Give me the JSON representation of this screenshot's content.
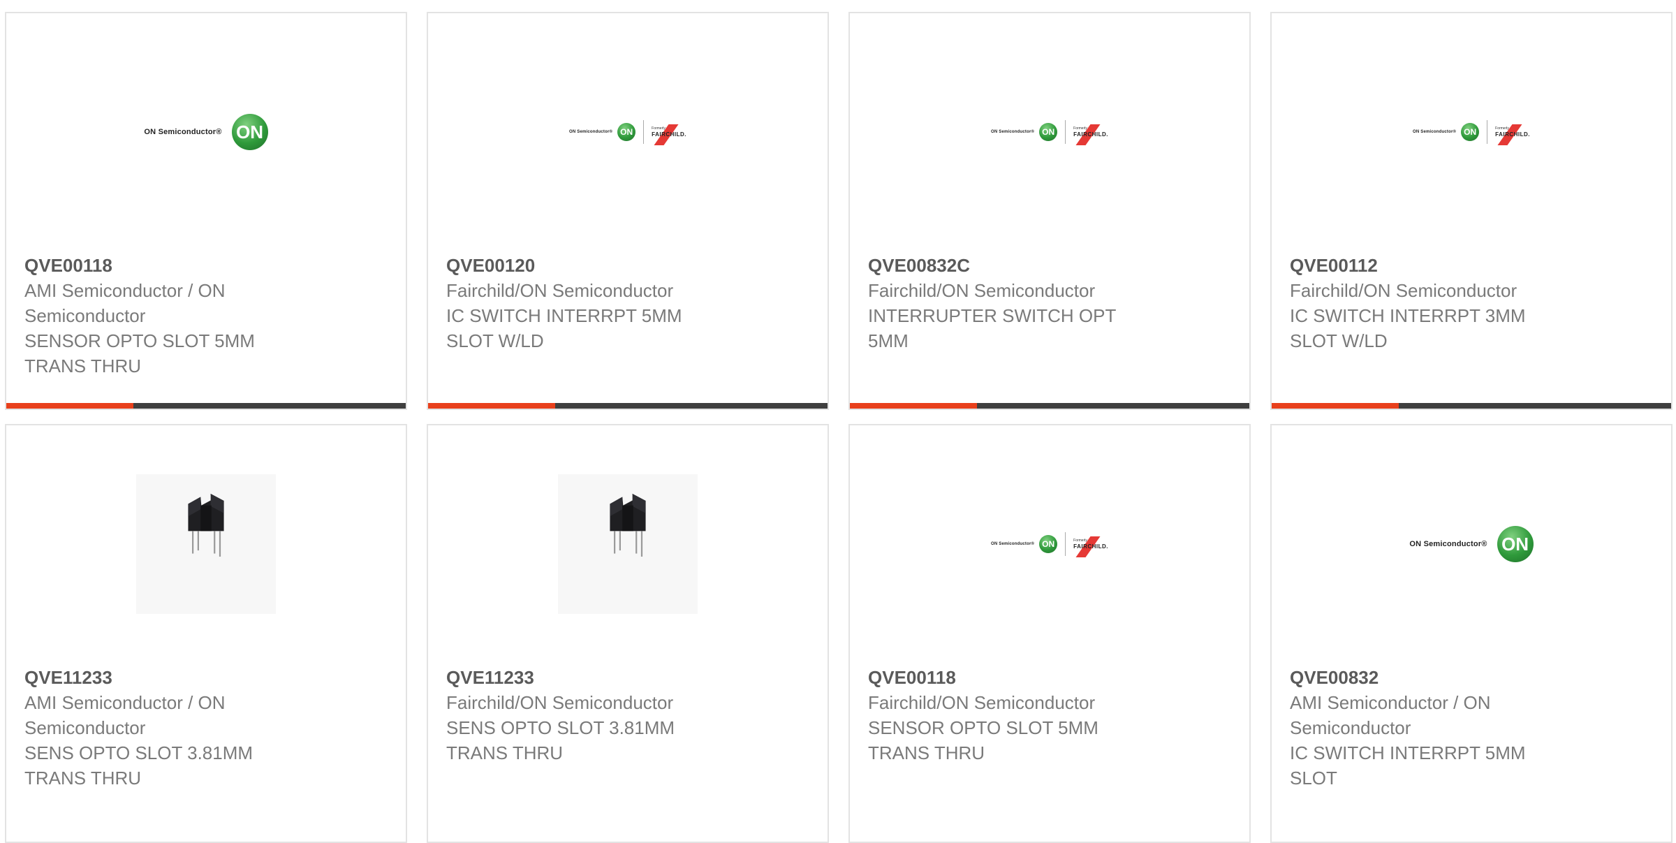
{
  "products": [
    {
      "part_number": "QVE00118",
      "manufacturer": "AMI Semiconductor / ON Semiconductor",
      "description": "SENSOR OPTO SLOT 5MM TRANS THRU",
      "image": "on-logo",
      "logo": {
        "text": "ON Semiconductor®",
        "mark": "ON"
      }
    },
    {
      "part_number": "QVE00120",
      "manufacturer": "Fairchild/ON Semiconductor",
      "description": "IC SWITCH INTERRPT 5MM SLOT W/LD",
      "image": "on-fairchild-logo",
      "logo": {
        "text": "ON Semiconductor®",
        "mark": "ON",
        "formerly": "Formerly",
        "fairchild": "FAIRCHILD."
      }
    },
    {
      "part_number": "QVE00832C",
      "manufacturer": "Fairchild/ON Semiconductor",
      "description": "INTERRUPTER SWITCH OPT 5MM",
      "image": "on-fairchild-logo",
      "logo": {
        "text": "ON Semiconductor®",
        "mark": "ON",
        "formerly": "Formerly",
        "fairchild": "FAIRCHILD."
      }
    },
    {
      "part_number": "QVE00112",
      "manufacturer": "Fairchild/ON Semiconductor",
      "description": "IC SWITCH INTERRPT 3MM SLOT W/LD",
      "image": "on-fairchild-logo",
      "logo": {
        "text": "ON Semiconductor®",
        "mark": "ON",
        "formerly": "Formerly",
        "fairchild": "FAIRCHILD."
      }
    },
    {
      "part_number": "QVE11233",
      "manufacturer": "AMI Semiconductor / ON Semiconductor",
      "description": "SENS OPTO SLOT 3.81MM TRANS THRU",
      "image": "slot-sensor-photo"
    },
    {
      "part_number": "QVE11233",
      "manufacturer": "Fairchild/ON Semiconductor",
      "description": "SENS OPTO SLOT 3.81MM TRANS THRU",
      "image": "slot-sensor-photo"
    },
    {
      "part_number": "QVE00118",
      "manufacturer": "Fairchild/ON Semiconductor",
      "description": "SENSOR OPTO SLOT 5MM TRANS THRU",
      "image": "on-fairchild-logo",
      "logo": {
        "text": "ON Semiconductor®",
        "mark": "ON",
        "formerly": "Formerly",
        "fairchild": "FAIRCHILD."
      }
    },
    {
      "part_number": "QVE00832",
      "manufacturer": "AMI Semiconductor / ON Semiconductor",
      "description": "IC SWITCH INTERRPT 5MM SLOT",
      "image": "on-logo",
      "logo": {
        "text": "ON Semiconductor®",
        "mark": "ON"
      }
    }
  ],
  "colors": {
    "accent_bar": "#e8401c",
    "bar_dark": "#3f3f3f",
    "part_number": "#5a5a5a",
    "body_text": "#7a7a7a",
    "card_border": "#e3e3e3"
  }
}
